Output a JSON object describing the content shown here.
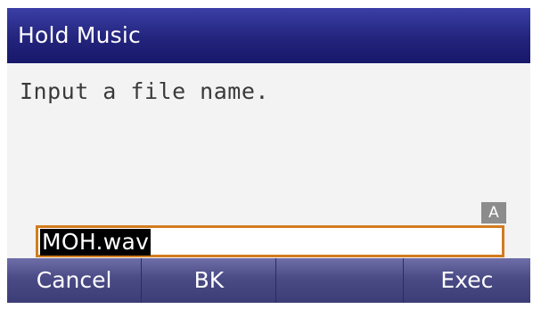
{
  "title": "Hold Music",
  "prompt": "Input a file name.",
  "input_mode": "A",
  "file_name_field": {
    "value": "MOH.wav"
  },
  "softkeys": [
    "Cancel",
    "BK",
    "",
    "Exec"
  ],
  "colors": {
    "title_bar": "#23247c",
    "softkey_bar": "#4a4a86",
    "input_border": "#d27c1e",
    "screen_background": "#f3f3f3"
  }
}
